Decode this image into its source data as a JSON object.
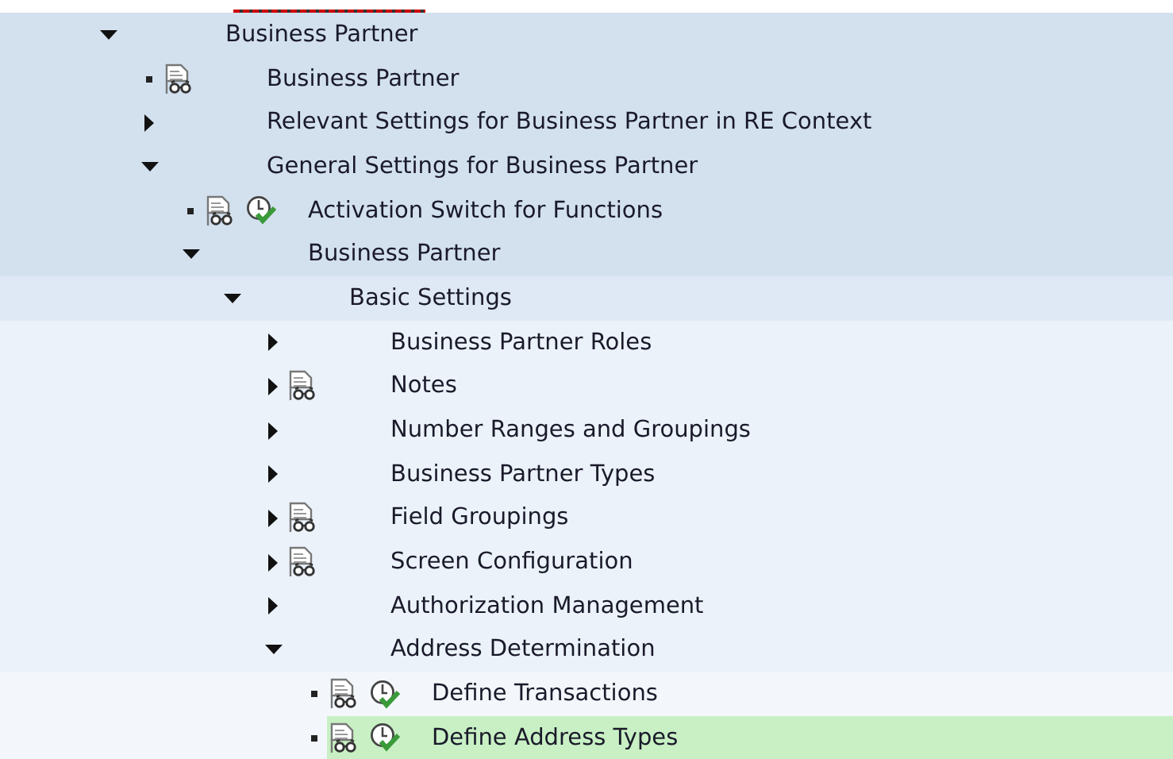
{
  "tree": [
    {
      "label": "Business Partner",
      "kind": "node",
      "expanded": true,
      "children": [
        {
          "label": "Business Partner",
          "kind": "leaf",
          "documentation": true,
          "activity": false
        },
        {
          "label": "Relevant Settings for Business Partner in RE Context",
          "kind": "node",
          "expanded": false
        },
        {
          "label": "General Settings for Business Partner",
          "kind": "node",
          "expanded": true,
          "children": [
            {
              "label": "Activation Switch for Functions",
              "kind": "leaf",
              "documentation": true,
              "activity": true
            },
            {
              "label": "Business Partner",
              "kind": "node",
              "expanded": true,
              "children": [
                {
                  "label": "Basic Settings",
                  "kind": "node",
                  "expanded": true,
                  "children": [
                    {
                      "label": "Business Partner Roles",
                      "kind": "node",
                      "expanded": false
                    },
                    {
                      "label": "Notes",
                      "kind": "node",
                      "expanded": false,
                      "documentation": true
                    },
                    {
                      "label": "Number Ranges and Groupings",
                      "kind": "node",
                      "expanded": false
                    },
                    {
                      "label": "Business Partner Types",
                      "kind": "node",
                      "expanded": false
                    },
                    {
                      "label": "Field Groupings",
                      "kind": "node",
                      "expanded": false,
                      "documentation": true
                    },
                    {
                      "label": "Screen Configuration",
                      "kind": "node",
                      "expanded": false,
                      "documentation": true
                    },
                    {
                      "label": "Authorization Management",
                      "kind": "node",
                      "expanded": false
                    },
                    {
                      "label": "Address Determination",
                      "kind": "node",
                      "expanded": true,
                      "children": [
                        {
                          "label": "Define Transactions",
                          "kind": "leaf",
                          "documentation": true,
                          "activity": true,
                          "selected": false
                        },
                        {
                          "label": "Define Address Types",
                          "kind": "leaf",
                          "documentation": true,
                          "activity": true,
                          "selected": true
                        }
                      ]
                    }
                  ]
                }
              ]
            }
          ]
        }
      ]
    }
  ]
}
